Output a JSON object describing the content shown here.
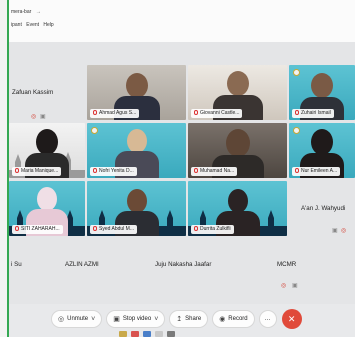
{
  "menu": {
    "row1": [
      "mera-bar",
      "→"
    ],
    "row2": [
      "ipant",
      "Event",
      "Help"
    ]
  },
  "tiles": [
    {
      "name": "Zafuan Kassim",
      "muted": true
    },
    {
      "name": "Ahmad Agus S..."
    },
    {
      "name": "Giovanni Castle..."
    },
    {
      "name": "Zuhairi Ismail"
    },
    {
      "name": "Maria Manique..."
    },
    {
      "name": "Nofri Yenita D..."
    },
    {
      "name": "Muhamad Na..."
    },
    {
      "name": "Nur Emileen A..."
    },
    {
      "name": "SITI ZAHARAH..."
    },
    {
      "name": "Syed Abdul M..."
    },
    {
      "name": "Durrita Zulkifli"
    },
    {
      "name": "A'an J. Wahyudi"
    }
  ],
  "bottom_names": [
    "i Su",
    "AZLIN AZMI",
    "Juju Nakasha Jaafar",
    "MCMR"
  ],
  "controls": {
    "unmute": "Unmute",
    "stop_video": "Stop video",
    "share": "Share",
    "record": "Record",
    "more": "…"
  },
  "icons": {
    "mic_muted": "◎",
    "video": "▣",
    "share": "↥",
    "record": "◉",
    "leave": "✕",
    "caret": "˅"
  },
  "colors": {
    "accent_green": "#35a853",
    "leave_red": "#e04a3a",
    "tile_teal": "#4bb6c8"
  }
}
